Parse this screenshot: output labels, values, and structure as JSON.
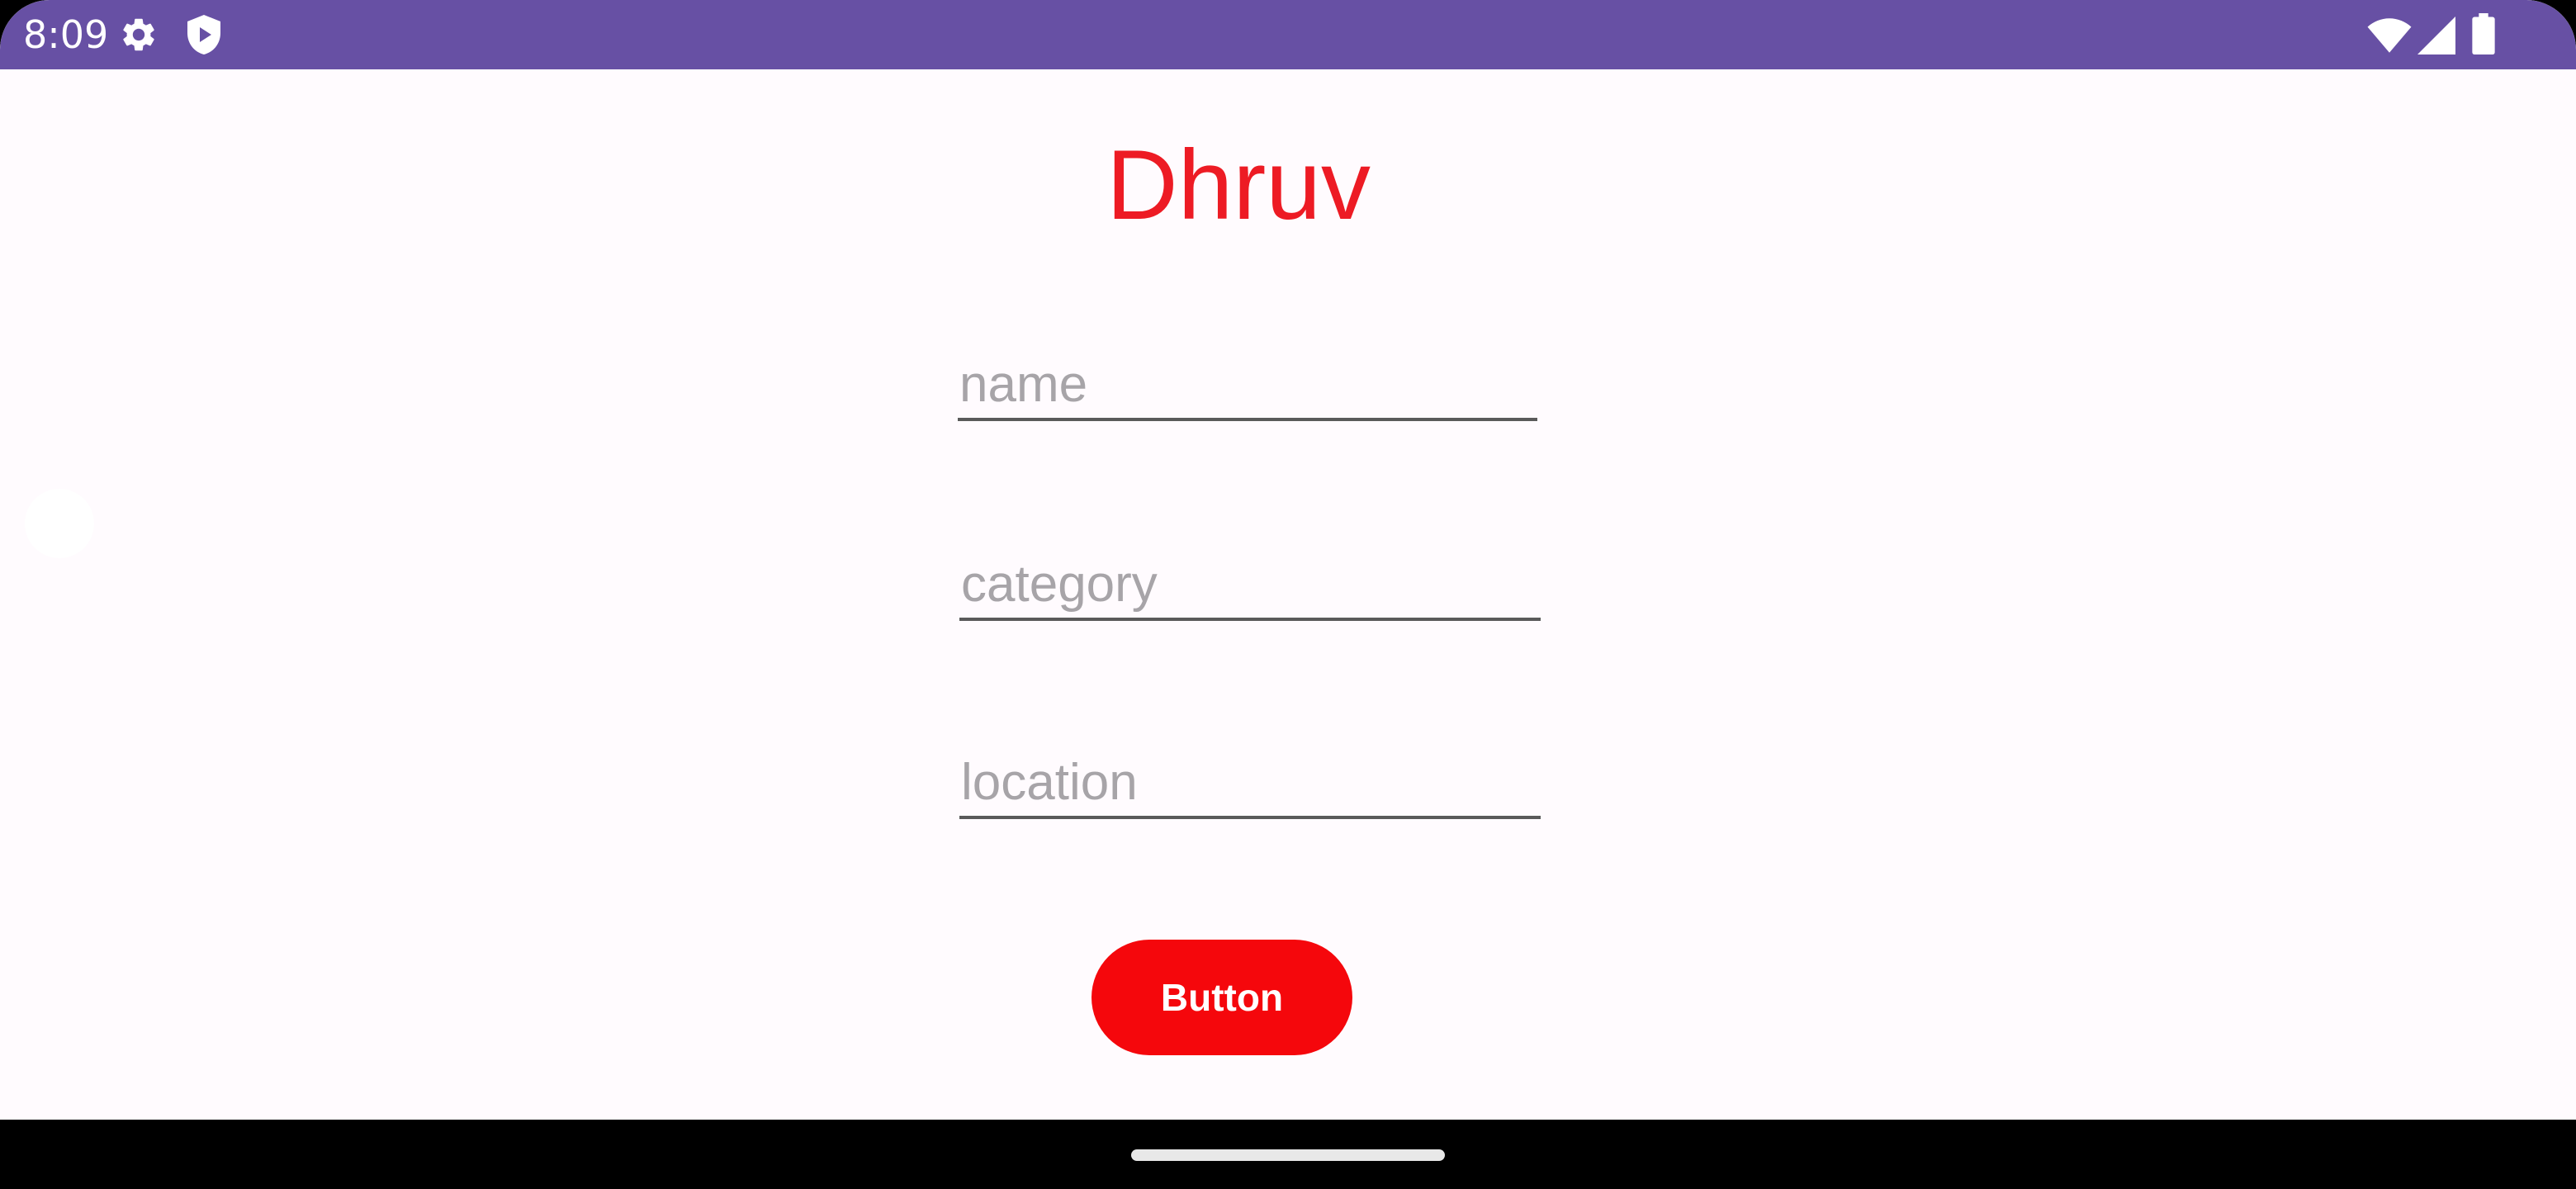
{
  "status_bar": {
    "time": "8:09",
    "left_icons": [
      "gear-icon",
      "shield-play-icon"
    ],
    "right_icons": [
      "wifi-icon",
      "cellular-signal-icon",
      "battery-icon"
    ],
    "background_color": "#6750a4"
  },
  "app": {
    "title": "Dhruv",
    "title_color": "#ed1b24",
    "fields": [
      {
        "placeholder": "name",
        "value": ""
      },
      {
        "placeholder": "category",
        "value": ""
      },
      {
        "placeholder": "location",
        "value": ""
      }
    ],
    "button_label": "Button",
    "button_color": "#f5070c"
  },
  "navigation": {
    "handle": "gesture-nav-handle"
  }
}
